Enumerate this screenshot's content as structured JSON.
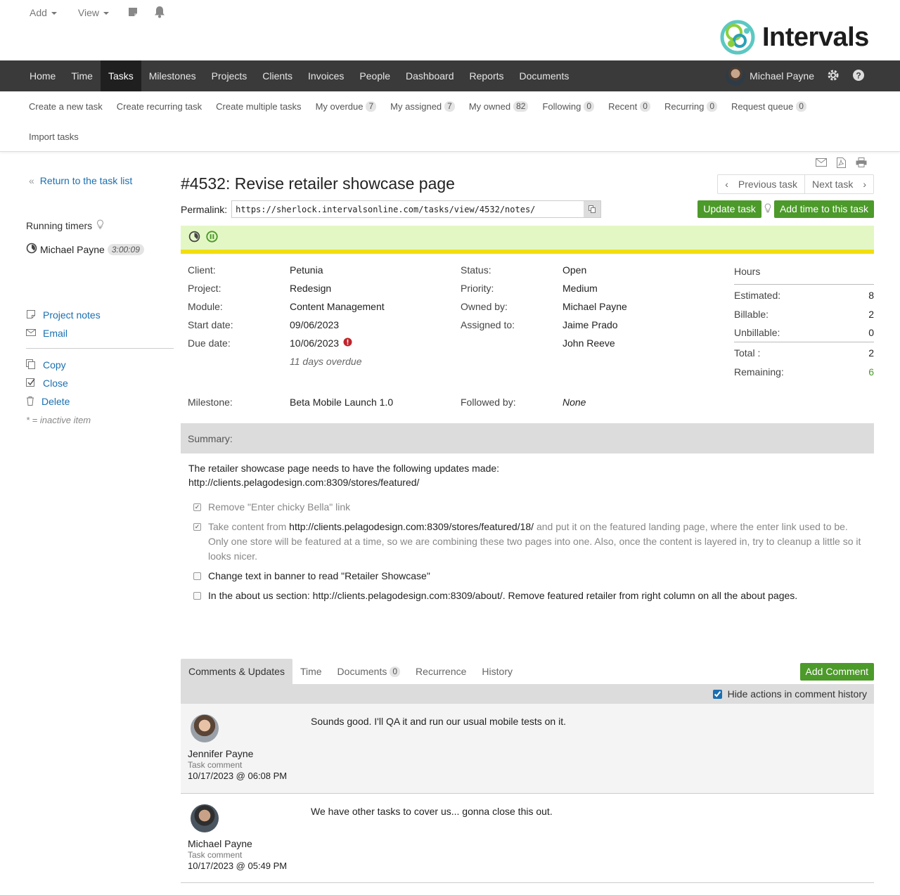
{
  "top": {
    "add_label": "Add",
    "view_label": "View",
    "logo_text": "Intervals"
  },
  "nav": {
    "items": [
      "Home",
      "Time",
      "Tasks",
      "Milestones",
      "Projects",
      "Clients",
      "Invoices",
      "People",
      "Dashboard",
      "Reports",
      "Documents"
    ],
    "active": "Tasks",
    "user_name": "Michael Payne"
  },
  "subnav": {
    "create_new": "Create a new task",
    "create_recurring": "Create recurring task",
    "create_multiple": "Create multiple tasks",
    "my_overdue": "My overdue",
    "my_overdue_count": "7",
    "my_assigned": "My assigned",
    "my_assigned_count": "7",
    "my_owned": "My owned",
    "my_owned_count": "82",
    "following": "Following",
    "following_count": "0",
    "recent": "Recent",
    "recent_count": "0",
    "recurring": "Recurring",
    "recurring_count": "0",
    "request_queue": "Request queue",
    "request_queue_count": "0",
    "import": "Import tasks"
  },
  "sidebar": {
    "back": "Return to the task list",
    "running_timers": "Running timers",
    "timer_user": "Michael Payne",
    "timer_value": "3:00:09",
    "project_notes": "Project notes",
    "email": "Email",
    "copy": "Copy",
    "close": "Close",
    "delete": "Delete",
    "inactive_note": "* = inactive item"
  },
  "task": {
    "title": "#4532: Revise retailer showcase page",
    "prev": "Previous task",
    "next": "Next task",
    "permalink_label": "Permalink:",
    "permalink_url": "https://sherlock.intervalsonline.com/tasks/view/4532/notes/",
    "update_btn": "Update task",
    "add_time_btn": "Add time to this task"
  },
  "fields": {
    "client_lbl": "Client:",
    "client": "Petunia",
    "project_lbl": "Project:",
    "project": "Redesign",
    "module_lbl": "Module:",
    "module": "Content Management",
    "start_lbl": "Start date:",
    "start": "09/06/2023",
    "due_lbl": "Due date:",
    "due": "10/06/2023",
    "overdue": "11 days overdue",
    "milestone_lbl": "Milestone:",
    "milestone": "Beta Mobile Launch 1.0",
    "status_lbl": "Status:",
    "status": "Open",
    "priority_lbl": "Priority:",
    "priority": "Medium",
    "owned_lbl": "Owned by:",
    "owned": "Michael Payne",
    "assigned_lbl": "Assigned to:",
    "assigned_1": "Jaime Prado",
    "assigned_2": "John Reeve",
    "followed_lbl": "Followed by:",
    "followed": "None"
  },
  "hours": {
    "heading": "Hours",
    "estimated_lbl": "Estimated:",
    "estimated": "8",
    "billable_lbl": "Billable:",
    "billable": "2",
    "unbillable_lbl": "Unbillable:",
    "unbillable": "0",
    "total_lbl": "Total :",
    "total": "2",
    "remaining_lbl": "Remaining:",
    "remaining": "6"
  },
  "summary": {
    "label": "Summary:",
    "line1": "The retailer showcase page needs to have the following updates made:",
    "line2": "http://clients.pelagodesign.com:8309/stores/featured/",
    "items": [
      {
        "checked": true,
        "text": "Remove \"Enter chicky Bella\" link"
      },
      {
        "checked": true,
        "pre": "Take content from ",
        "url": "http://clients.pelagodesign.com:8309/stores/featured/18/",
        "post": " and put it on the featured landing page, where the enter link used to be. Only one store will be featured at a time, so we are combining these two pages into one. Also, once the content is layered in, try to cleanup a little so it looks nicer."
      },
      {
        "checked": false,
        "text": "Change text in banner to read \"Retailer Showcase\""
      },
      {
        "checked": false,
        "text": "In the about us section: http://clients.pelagodesign.com:8309/about/. Remove featured retailer from right column on all the about pages."
      }
    ]
  },
  "tabs": {
    "comments": "Comments & Updates",
    "time": "Time",
    "documents": "Documents",
    "documents_count": "0",
    "recurrence": "Recurrence",
    "history": "History",
    "add_comment": "Add Comment",
    "hide_actions": "Hide actions in comment history"
  },
  "comments": [
    {
      "name": "Jennifer Payne",
      "type": "Task comment",
      "date": "10/17/2023 @ 06:08 PM",
      "body": "Sounds good. I'll QA it and run our usual mobile tests on it."
    },
    {
      "name": "Michael Payne",
      "type": "Task comment",
      "date": "10/17/2023 @ 05:49 PM",
      "body": "We have other tasks to cover us... gonna close this out."
    }
  ],
  "colors": {
    "nav_bg": "#3a3a3a",
    "accent_green": "#4c9a2a",
    "timer_bar": "#e3f7c5",
    "timer_stripe": "#f2de0f",
    "link": "#1a6fb0"
  }
}
